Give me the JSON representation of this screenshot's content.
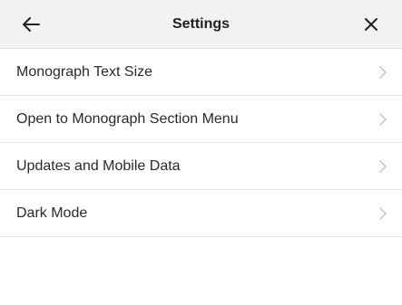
{
  "header": {
    "title": "Settings",
    "back_icon": "arrow-left-icon",
    "close_icon": "close-icon"
  },
  "settings": {
    "items": [
      {
        "label": "Monograph Text Size",
        "icon": "chevron-right-icon"
      },
      {
        "label": "Open to Monograph Section Menu",
        "icon": "chevron-right-icon"
      },
      {
        "label": "Updates and Mobile Data",
        "icon": "chevron-right-icon"
      },
      {
        "label": "Dark Mode",
        "icon": "chevron-right-icon"
      }
    ]
  },
  "colors": {
    "header_background": "#f2f2f2",
    "divider": "#e4e4e4",
    "chevron": "#c4c4c4",
    "text": "#2a2a2a"
  }
}
